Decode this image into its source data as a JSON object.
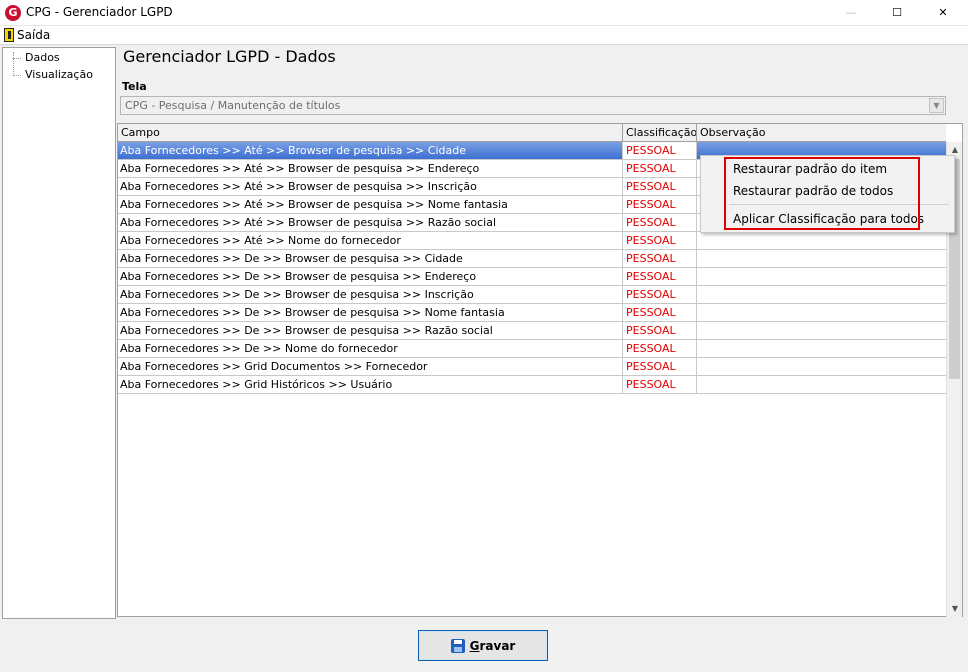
{
  "window": {
    "title": "CPG - Gerenciador LGPD",
    "icon_letter": "G",
    "minimize_glyph": "—",
    "maximize_glyph": "☐",
    "close_glyph": "✕"
  },
  "menu": {
    "exit_label": "Saída"
  },
  "tree": {
    "items": [
      "Dados",
      "Visualização"
    ]
  },
  "page": {
    "title": "Gerenciador LGPD - Dados",
    "tela_label": "Tela",
    "tela_value": "CPG - Pesquisa / Manutenção de títulos"
  },
  "grid": {
    "columns": [
      "Campo",
      "Classificação",
      "Observação"
    ],
    "rows": [
      {
        "campo": "Aba Fornecedores >> Até >> Browser de pesquisa >> Cidade",
        "classificacao": "PESSOAL",
        "observacao": ""
      },
      {
        "campo": "Aba Fornecedores >> Até >> Browser de pesquisa >> Endereço",
        "classificacao": "PESSOAL",
        "observacao": ""
      },
      {
        "campo": "Aba Fornecedores >> Até >> Browser de pesquisa >> Inscrição",
        "classificacao": "PESSOAL",
        "observacao": ""
      },
      {
        "campo": "Aba Fornecedores >> Até >> Browser de pesquisa >> Nome fantasia",
        "classificacao": "PESSOAL",
        "observacao": ""
      },
      {
        "campo": "Aba Fornecedores >> Até >> Browser de pesquisa >> Razão social",
        "classificacao": "PESSOAL",
        "observacao": ""
      },
      {
        "campo": "Aba Fornecedores >> Até >> Nome do fornecedor",
        "classificacao": "PESSOAL",
        "observacao": ""
      },
      {
        "campo": "Aba Fornecedores >> De >> Browser de pesquisa >> Cidade",
        "classificacao": "PESSOAL",
        "observacao": ""
      },
      {
        "campo": "Aba Fornecedores >> De >> Browser de pesquisa >> Endereço",
        "classificacao": "PESSOAL",
        "observacao": ""
      },
      {
        "campo": "Aba Fornecedores >> De >> Browser de pesquisa >> Inscrição",
        "classificacao": "PESSOAL",
        "observacao": ""
      },
      {
        "campo": "Aba Fornecedores >> De >> Browser de pesquisa >> Nome fantasia",
        "classificacao": "PESSOAL",
        "observacao": ""
      },
      {
        "campo": "Aba Fornecedores >> De >> Browser de pesquisa >> Razão social",
        "classificacao": "PESSOAL",
        "observacao": ""
      },
      {
        "campo": "Aba Fornecedores >> De >> Nome do fornecedor",
        "classificacao": "PESSOAL",
        "observacao": ""
      },
      {
        "campo": "Aba Fornecedores >> Grid Documentos >> Fornecedor",
        "classificacao": "PESSOAL",
        "observacao": ""
      },
      {
        "campo": "Aba Fornecedores >> Grid Históricos >> Usuário",
        "classificacao": "PESSOAL",
        "observacao": ""
      }
    ],
    "selected_row": 0
  },
  "context_menu": {
    "items": [
      "Restaurar padrão do item",
      "Restaurar padrão de todos",
      "Aplicar Classificação para todos"
    ]
  },
  "footer": {
    "save_button": {
      "mnemonic": "G",
      "rest": "ravar"
    }
  },
  "colors": {
    "classification_text": "#e00000",
    "selection": "#3d6fd3",
    "highlight_box": "#e00000",
    "button_border": "#0f5fb0"
  }
}
